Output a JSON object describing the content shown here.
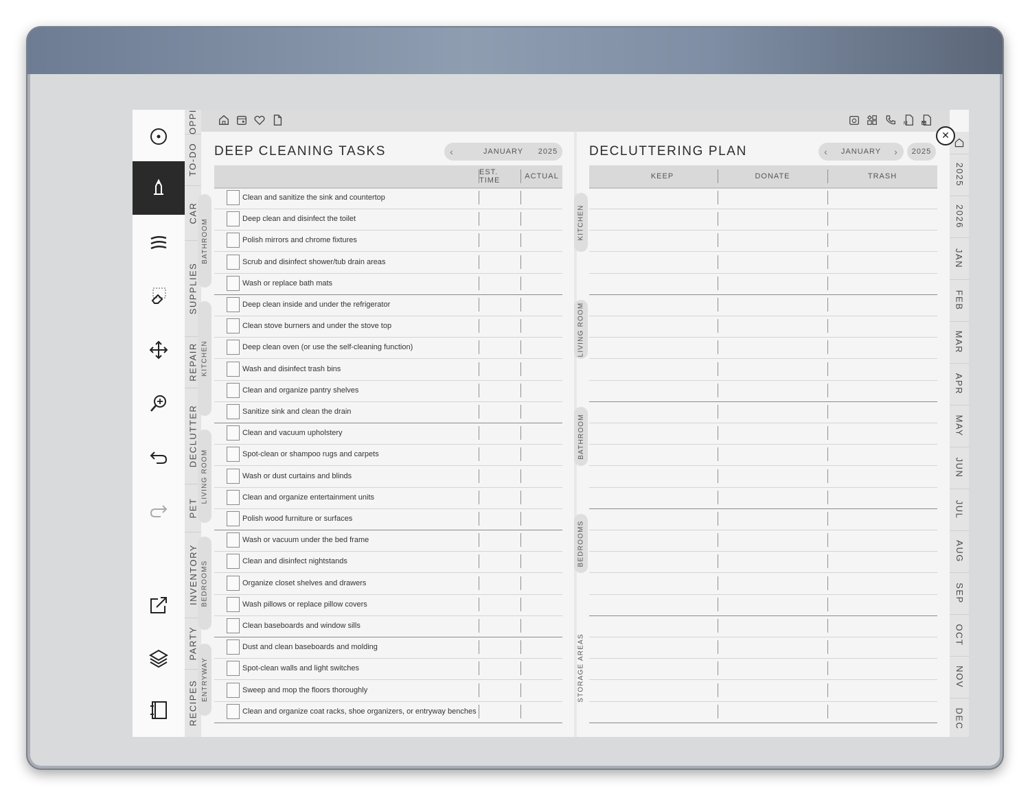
{
  "toolbar": {
    "tools": [
      {
        "name": "menu-icon"
      },
      {
        "name": "pen-tool-icon",
        "active": true
      },
      {
        "name": "lines-icon"
      },
      {
        "name": "eraser-icon"
      },
      {
        "name": "move-icon"
      },
      {
        "name": "zoom-icon"
      },
      {
        "name": "undo-icon"
      },
      {
        "name": "redo-icon"
      },
      {
        "name": "share-icon"
      },
      {
        "name": "layers-icon"
      },
      {
        "name": "notebook-icon"
      }
    ]
  },
  "category_tabs": [
    "OPPI",
    "TO-DO",
    "CAR",
    "SUPPLIES",
    "REPAIR",
    "DECLUTTER",
    "PET",
    "INVENTORY",
    "PARTY",
    "RECIPES"
  ],
  "nav": {
    "left_icons": [
      "home-icon",
      "calendar-icon",
      "heart-icon",
      "document-icon"
    ],
    "right_icons": [
      "search-calendar-icon",
      "grid-icon",
      "phone-icon",
      "m-doc-icon",
      "mail-doc-icon"
    ]
  },
  "left": {
    "title": "DEEP CLEANING TASKS",
    "month": "JANUARY",
    "year": "2025",
    "col_est": "EST. TIME",
    "col_actual": "ACTUAL",
    "groups": [
      {
        "label": "BATHROOM",
        "tasks": [
          "Clean and sanitize the sink and countertop",
          "Deep clean and disinfect the toilet",
          "Polish mirrors and chrome fixtures",
          "Scrub and disinfect shower/tub drain areas",
          "Wash or replace bath mats"
        ]
      },
      {
        "label": "KITCHEN",
        "tasks": [
          "Deep clean inside and under the refrigerator",
          "Clean stove burners and under the stove top",
          "Deep clean oven (or use the self-cleaning function)",
          "Wash and disinfect trash bins",
          "Clean and organize pantry shelves",
          "Sanitize sink and clean the drain"
        ]
      },
      {
        "label": "LIVING ROOM",
        "tasks": [
          "Clean and vacuum upholstery",
          "Spot-clean or shampoo rugs and carpets",
          "Wash or dust curtains and blinds",
          "Clean and organize entertainment units",
          "Polish wood furniture or surfaces"
        ]
      },
      {
        "label": "BEDROOMS",
        "tasks": [
          "Wash or vacuum under the bed frame",
          "Clean and disinfect nightstands",
          "Organize closet shelves and drawers",
          "Wash pillows or replace pillow covers",
          "Clean baseboards and window sills"
        ]
      },
      {
        "label": "ENTRYWAY",
        "tasks": [
          "Dust and clean baseboards and molding",
          "Spot-clean walls and light switches",
          "Sweep and mop the floors thoroughly",
          "Clean and organize coat racks, shoe organizers, or entryway benches"
        ]
      }
    ]
  },
  "right": {
    "title": "DECLUTTERING PLAN",
    "month": "JANUARY",
    "year": "2025",
    "columns": [
      "KEEP",
      "DONATE",
      "TRASH"
    ],
    "groups": [
      {
        "label": "KITCHEN",
        "rows": 5
      },
      {
        "label": "LIVING ROOM",
        "rows": 5
      },
      {
        "label": "BATHROOM",
        "rows": 5
      },
      {
        "label": "BEDROOMS",
        "rows": 5
      },
      {
        "label": "STORAGE AREAS",
        "rows": 5
      }
    ]
  },
  "side_tabs": [
    "2025",
    "2026",
    "JAN",
    "FEB",
    "MAR",
    "APR",
    "MAY",
    "JUN",
    "JUL",
    "AUG",
    "SEP",
    "OCT",
    "NOV",
    "DEC"
  ],
  "close_symbol": "✕"
}
